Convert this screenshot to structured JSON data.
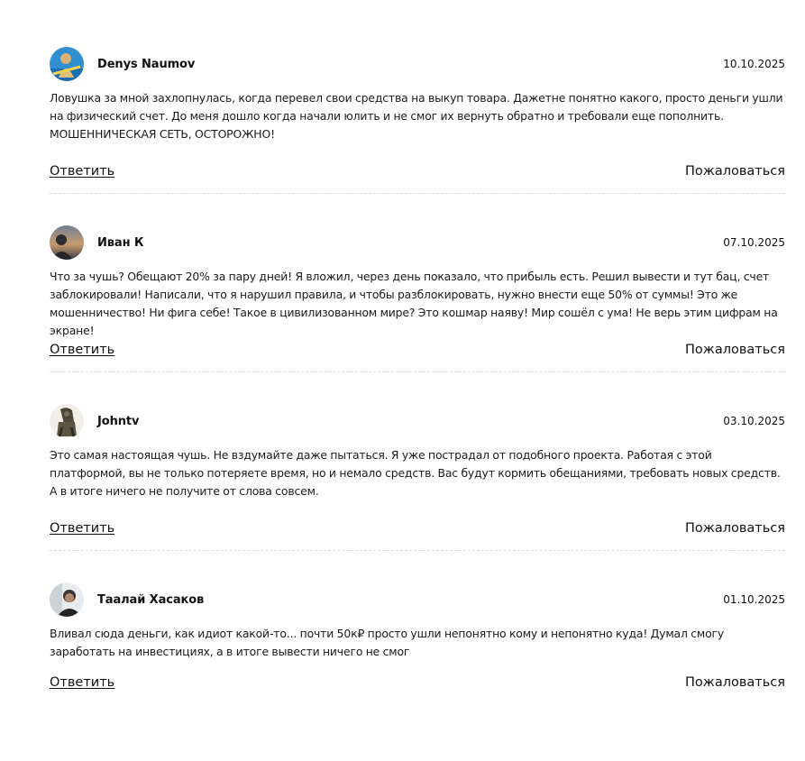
{
  "comments": [
    {
      "author": "Denys Naumov",
      "date": "10.10.2025",
      "avatar_icon": "user-avatar-photo",
      "text": "Ловушка за мной захлопнулась, когда перевел свои средства на выкуп товара. Дажетне понятно какого, просто деньги ушли на физический счет. До меня дошло когда начали юлить и не смог их вернуть обратно и требовали еще пополнить. МОШЕННИЧЕСКАЯ СЕТЬ, ОСТОРОЖНО!",
      "reply_label": "Ответить",
      "report_label": "Пожаловаться"
    },
    {
      "author": "Иван К",
      "date": "07.10.2025",
      "avatar_icon": "user-avatar-photo",
      "text": "Что за чушь? Обещают 20% за пару дней! Я вложил, через день показало, что прибыль есть. Решил вывести и тут бац, счет заблокировали! Написали, что я нарушил правила, и чтобы разблокировать, нужно внести еще 50% от суммы! Это же мошенничество! Ни фига себе! Такое в цивилизованном мире? Это кошмар наяву! Мир сошёл с ума! Не верь этим цифрам на экране!",
      "reply_label": "Ответить",
      "report_label": "Пожаловаться"
    },
    {
      "author": "Johntv",
      "date": "03.10.2025",
      "avatar_icon": "user-avatar-photo",
      "text": "Это самая настоящая чушь. Не вздумайте даже пытаться. Я уже пострадал от подобного проекта. Работая с этой платформой, вы не только потеряете время, но и немало средств. Вас будут кормить обещаниями, требовать новых средств. А в итоге ничего не получите от слова совсем.",
      "reply_label": "Ответить",
      "report_label": "Пожаловаться"
    },
    {
      "author": "Таалай Хасаков",
      "date": "01.10.2025",
      "avatar_icon": "user-avatar-photo",
      "text": "Вливал сюда деньги, как идиот какой-то... почти 50к₽ просто ушли непонятно кому и непонятно куда! Думал смогу заработать на инвестициях, а в итоге вывести ничего не смог",
      "reply_label": "Ответить",
      "report_label": "Пожаловаться"
    }
  ]
}
